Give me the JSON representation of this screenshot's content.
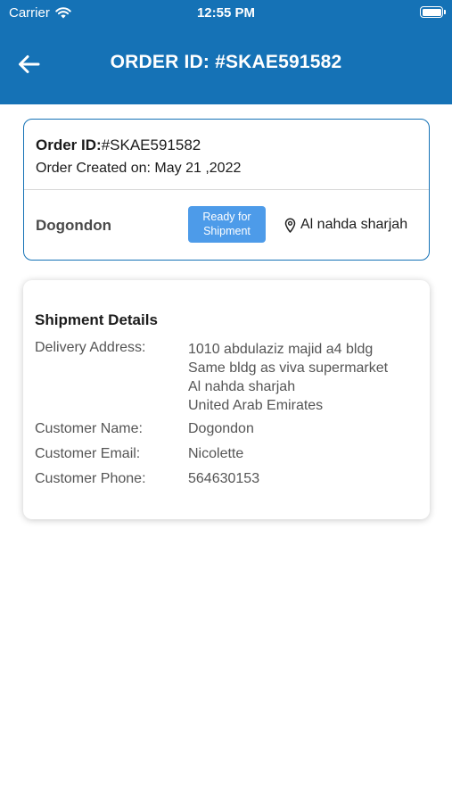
{
  "status_bar": {
    "carrier": "Carrier",
    "time": "12:55 PM"
  },
  "header": {
    "title": "ORDER ID: #SKAE591582",
    "back_icon": "arrow-left-icon",
    "background": "#1572b6"
  },
  "order": {
    "id_label": "Order ID:",
    "id_value": "#SKAE591582",
    "created_label": "Order Created on:",
    "created_value": "May 21 ,2022",
    "customer": "Dogondon",
    "status_badge": [
      "Ready for",
      "Shipment"
    ],
    "status_color": "#4d9be9",
    "location": "Al nahda sharjah"
  },
  "shipment": {
    "heading": "Shipment Details",
    "address_label": "Delivery Address:",
    "address_lines": [
      "1010 abdulaziz majid a4 bldg",
      "Same bldg as viva supermarket",
      "Al nahda sharjah",
      "United Arab Emirates"
    ],
    "name_label": "Customer Name:",
    "name_value": "Dogondon",
    "email_label": "Customer Email:",
    "email_value": "Nicolette",
    "phone_label": "Customer Phone:",
    "phone_value": "564630153"
  }
}
